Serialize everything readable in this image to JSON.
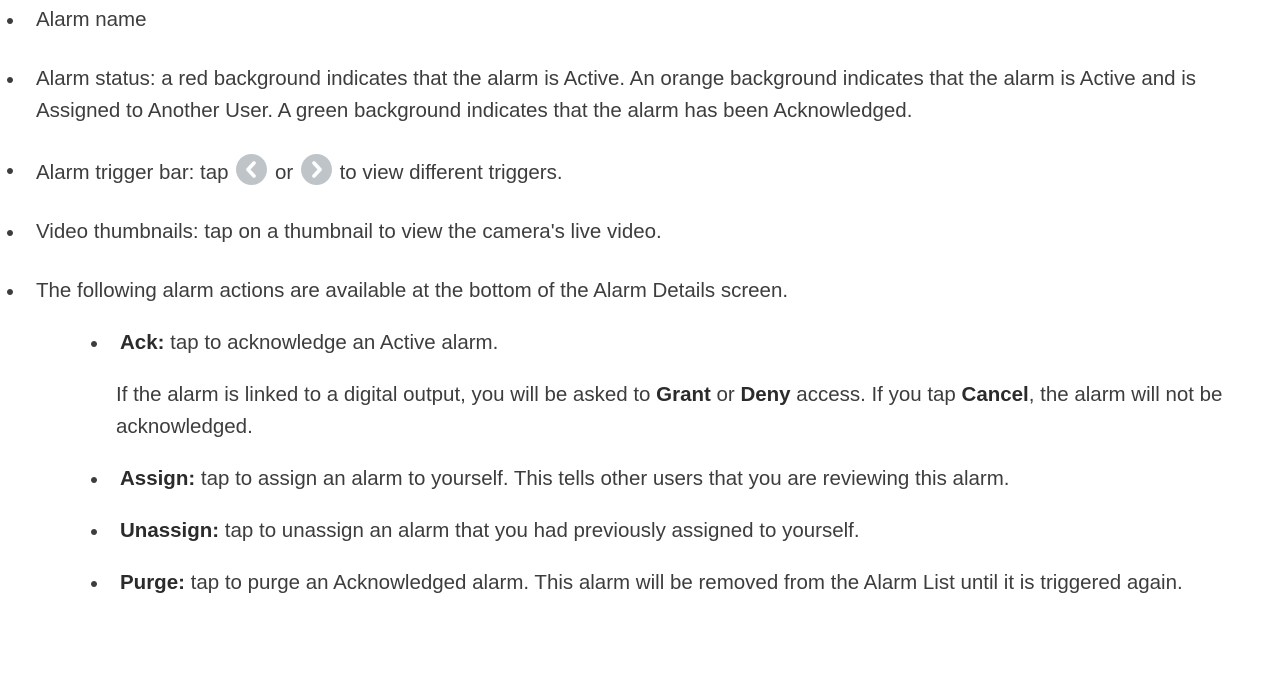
{
  "items": [
    {
      "text": "Alarm name"
    },
    {
      "text": "Alarm status: a red background indicates that the alarm is Active. An orange background indicates that the alarm is Active and is Assigned to Another User. A green background indicates that the alarm has been Acknowledged."
    },
    {
      "prefix": "Alarm trigger bar: tap",
      "or": "or",
      "suffix": "to view different triggers.",
      "icons": [
        "chevron-left-circle-icon",
        "chevron-right-circle-icon"
      ]
    },
    {
      "text": "Video thumbnails: tap on a thumbnail to view the camera's live video."
    },
    {
      "text": "The following alarm actions are available at the bottom of the Alarm Details screen."
    }
  ],
  "actions": {
    "ack": {
      "label": "Ack:",
      "text": " tap to acknowledge an Active alarm.",
      "note": {
        "part1": "If the alarm is linked to a digital output, you will be asked to ",
        "grant": "Grant",
        "part2": " or ",
        "deny": "Deny",
        "part3": " access. If you tap ",
        "cancel": "Cancel",
        "part4": ", the alarm will not be acknowledged."
      }
    },
    "assign": {
      "label": "Assign:",
      "text": " tap to assign an alarm to yourself. This tells other users that you are reviewing this alarm."
    },
    "unassign": {
      "label": "Unassign:",
      "text": " tap to unassign an alarm that you had previously assigned to yourself."
    },
    "purge": {
      "label": "Purge:",
      "text": " tap to purge an Acknowledged alarm. This alarm will be removed from the Alarm List until it is triggered again."
    }
  }
}
